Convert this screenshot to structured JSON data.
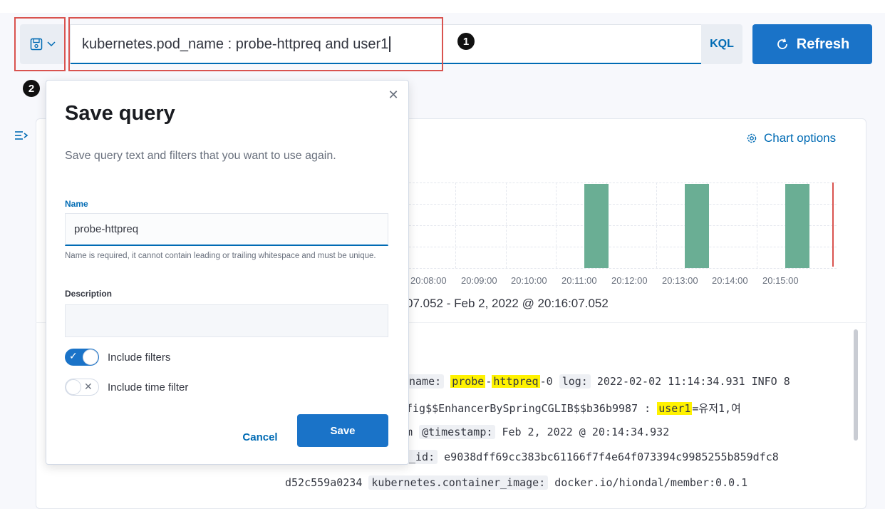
{
  "query_bar": {
    "query_text": "kubernetes.pod_name : probe-httpreq and user1",
    "language_label": "KQL",
    "refresh_label": "Refresh"
  },
  "callouts": {
    "one": "1",
    "two": "2"
  },
  "chart": {
    "options_label": "Chart options",
    "time_range_text": "07.052 - Feb 2, 2022 @ 20:16:07.052"
  },
  "chart_data": {
    "type": "bar",
    "categories": [
      "20:08:00",
      "20:09:00",
      "20:10:00",
      "20:11:00",
      "20:12:00",
      "20:13:00",
      "20:14:00",
      "20:15:00"
    ],
    "values": [
      0,
      0,
      0,
      1,
      0,
      1,
      0,
      1
    ],
    "xlabel": "",
    "ylabel": "",
    "grid": true,
    "bar_color": "#6aae94"
  },
  "document": {
    "line1": {
      "prefix": "name:",
      "pod_hl_a": "probe",
      "pod_dash": "-",
      "pod_hl_b": "httpreq",
      "pod_suffix": "-0",
      "log_field": "log:",
      "log_text": "2022-02-02 11:14:34.931 INFO 8"
    },
    "line2": {
      "text_a": "fig$$EnhancerBySpringCGLIB$$b36b9987 : ",
      "hl": "user1",
      "text_b": "=유저1,여"
    },
    "line3": {
      "text_a": "m ",
      "field": "@timestamp:",
      "text_b": "Feb 2, 2022 @ 20:14:34.932"
    },
    "line4": {
      "field": "_id:",
      "text_b": "e9038dff69cc383bc61166f7f4e64f073394c9985255b859dfc8"
    },
    "line5": {
      "text_a": "d52c559a0234",
      "field": "kubernetes.container_image:",
      "text_b": "docker.io/hiondal/member:0.0.1"
    }
  },
  "modal": {
    "title": "Save query",
    "description": "Save query text and filters that you want to use again.",
    "name_label": "Name",
    "name_value": "probe-httpreq",
    "name_help": "Name is required, it cannot contain leading or trailing whitespace and must be unique.",
    "description_label": "Description",
    "description_value": "",
    "include_filters_label": "Include filters",
    "include_filters_on": true,
    "include_time_filter_label": "Include time filter",
    "include_time_filter_on": false,
    "cancel_label": "Cancel",
    "save_label": "Save"
  },
  "colors": {
    "accent": "#006bb4",
    "primary_button": "#1a73c8",
    "annotation_red": "#d9534f",
    "highlight": "#fff200"
  }
}
